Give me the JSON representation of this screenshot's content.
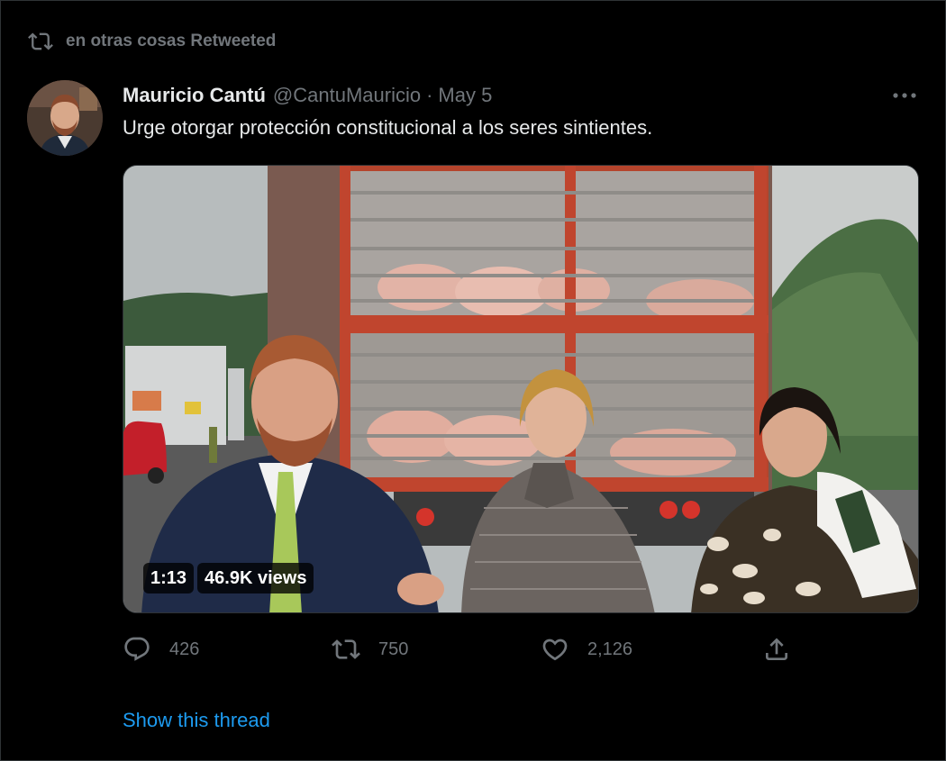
{
  "social_context": {
    "text": "en otras cosas Retweeted",
    "icon": "retweet-icon"
  },
  "tweet": {
    "author_name": "Mauricio Cantú",
    "handle": "@CantuMauricio",
    "separator": "·",
    "date": "May 5",
    "text": "Urge otorgar protección constitucional a los seres sintientes.",
    "video": {
      "duration": "1:13",
      "views": "46.9K views"
    },
    "actions": {
      "replies": "426",
      "retweets": "750",
      "likes": "2,126"
    },
    "show_thread": "Show this thread"
  },
  "colors": {
    "background": "#000000",
    "text_primary": "#e7e9ea",
    "text_secondary": "#71767b",
    "link": "#1d9bf0",
    "border": "#2f3336"
  }
}
